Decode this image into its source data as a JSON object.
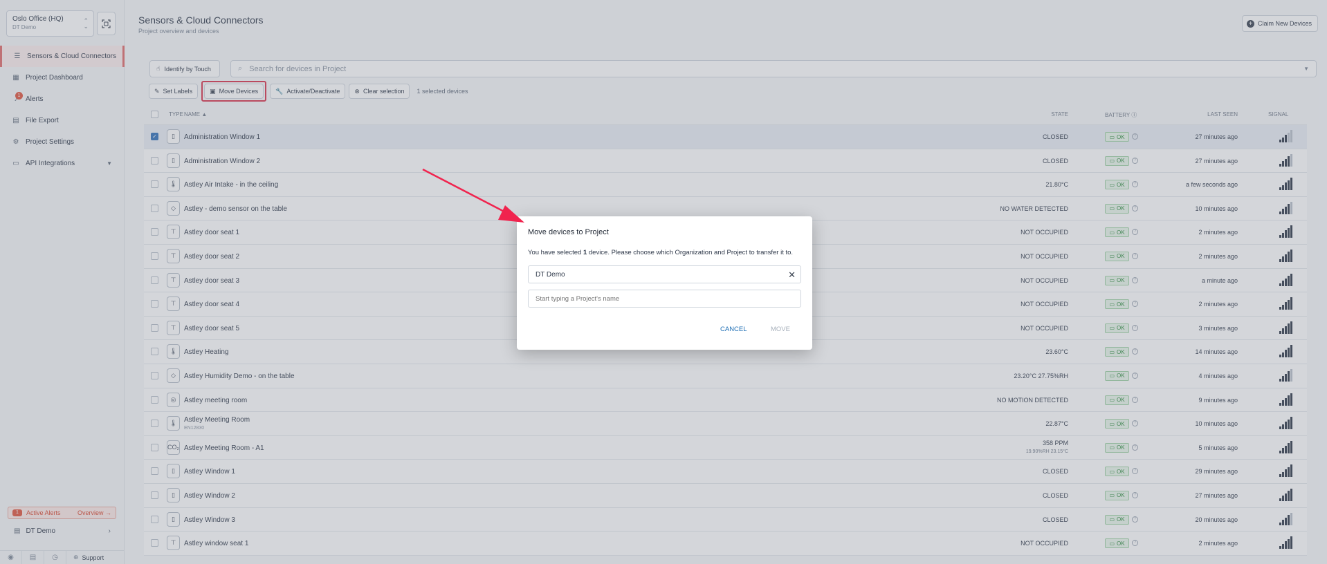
{
  "sidebar": {
    "org_name": "Oslo Office (HQ)",
    "org_sub": "DT Demo",
    "nav": [
      {
        "label": "Sensors & Cloud Connectors",
        "icon": "list-icon",
        "active": true
      },
      {
        "label": "Project Dashboard",
        "icon": "dashboard-icon"
      },
      {
        "label": "Alerts",
        "icon": "bell-icon",
        "badge": "1"
      },
      {
        "label": "File Export",
        "icon": "export-icon"
      },
      {
        "label": "Project Settings",
        "icon": "settings-icon"
      },
      {
        "label": "API Integrations",
        "icon": "api-icon"
      }
    ],
    "active_alerts": {
      "badge": "1",
      "label": "Active Alerts",
      "overview": "Overview"
    },
    "org_item": "DT Demo",
    "support": "Support"
  },
  "header": {
    "title": "Sensors & Cloud Connectors",
    "subtitle": "Project overview and devices",
    "claim_label": "Claim New Devices"
  },
  "toolbar": {
    "identify_label": "Identify by Touch",
    "search_placeholder": "Search for devices in Project",
    "set_labels": "Set Labels",
    "move_devices": "Move Devices",
    "activate": "Activate/Deactivate",
    "clear": "Clear selection",
    "selected_count": "1 selected devices"
  },
  "table": {
    "columns": {
      "type": "TYPE",
      "name": "NAME",
      "state": "STATE",
      "battery": "BATTERY",
      "last_seen": "LAST SEEN",
      "signal": "SIGNAL"
    },
    "rows": [
      {
        "name": "Administration Window 1",
        "icon": "window-icon",
        "glyph": "▯",
        "state": "CLOSED",
        "battery": "OK",
        "seen": "27 minutes ago",
        "bars": 3,
        "selected": true
      },
      {
        "name": "Administration Window 2",
        "icon": "window-icon",
        "glyph": "▯",
        "state": "CLOSED",
        "battery": "OK",
        "seen": "27 minutes ago",
        "bars": 4
      },
      {
        "name": "Astley Air Intake - in the ceiling",
        "icon": "thermometer-icon",
        "glyph": "🌡",
        "state": "21.80°C",
        "battery": "OK",
        "seen": "a few seconds ago",
        "bars": 5
      },
      {
        "name": "Astley - demo sensor on the table",
        "icon": "water-drop-icon",
        "glyph": "◇",
        "state": "NO WATER DETECTED",
        "battery": "OK",
        "seen": "10 minutes ago",
        "bars": 4
      },
      {
        "name": "Astley door seat 1",
        "icon": "desk-icon",
        "glyph": "⊤",
        "state": "NOT OCCUPIED",
        "battery": "OK",
        "seen": "2 minutes ago",
        "bars": 5
      },
      {
        "name": "Astley door seat 2",
        "icon": "desk-icon",
        "glyph": "⊤",
        "state": "NOT OCCUPIED",
        "battery": "OK",
        "seen": "2 minutes ago",
        "bars": 5
      },
      {
        "name": "Astley door seat 3",
        "icon": "desk-icon",
        "glyph": "⊤",
        "state": "NOT OCCUPIED",
        "battery": "OK",
        "seen": "a minute ago",
        "bars": 5
      },
      {
        "name": "Astley door seat 4",
        "icon": "desk-icon",
        "glyph": "⊤",
        "state": "NOT OCCUPIED",
        "battery": "OK",
        "seen": "2 minutes ago",
        "bars": 5
      },
      {
        "name": "Astley door seat 5",
        "icon": "desk-icon",
        "glyph": "⊤",
        "state": "NOT OCCUPIED",
        "battery": "OK",
        "seen": "3 minutes ago",
        "bars": 5
      },
      {
        "name": "Astley Heating",
        "icon": "thermometer-icon",
        "glyph": "🌡",
        "state": "23.60°C",
        "battery": "OK",
        "seen": "14 minutes ago",
        "bars": 5
      },
      {
        "name": "Astley Humidity Demo - on the table",
        "icon": "humidity-icon",
        "glyph": "◇",
        "state": "23.20°C 27.75%RH",
        "battery": "OK",
        "seen": "4 minutes ago",
        "bars": 4
      },
      {
        "name": "Astley meeting room",
        "icon": "motion-icon",
        "glyph": "◎",
        "state": "NO MOTION DETECTED",
        "battery": "OK",
        "seen": "9 minutes ago",
        "bars": 5
      },
      {
        "name": "Astley Meeting Room",
        "sub": "EN12830",
        "icon": "thermometer-icon",
        "glyph": "🌡",
        "state": "22.87°C",
        "battery": "OK",
        "seen": "10 minutes ago",
        "bars": 5
      },
      {
        "name": "Astley Meeting Room - A1",
        "icon": "co2-icon",
        "glyph": "CO₂",
        "state": "358 PPM",
        "state2": "19.90%RH 23.15°C",
        "battery": "OK",
        "seen": "5 minutes ago",
        "bars": 5
      },
      {
        "name": "Astley Window 1",
        "icon": "window-icon",
        "glyph": "▯",
        "state": "CLOSED",
        "battery": "OK",
        "seen": "29 minutes ago",
        "bars": 5
      },
      {
        "name": "Astley Window 2",
        "icon": "window-icon",
        "glyph": "▯",
        "state": "CLOSED",
        "battery": "OK",
        "seen": "27 minutes ago",
        "bars": 5
      },
      {
        "name": "Astley Window 3",
        "icon": "window-icon",
        "glyph": "▯",
        "state": "CLOSED",
        "battery": "OK",
        "seen": "20 minutes ago",
        "bars": 4
      },
      {
        "name": "Astley window seat 1",
        "icon": "desk-icon",
        "glyph": "⊤",
        "state": "NOT OCCUPIED",
        "battery": "OK",
        "seen": "2 minutes ago",
        "bars": 5
      }
    ]
  },
  "modal": {
    "title": "Move devices to Project",
    "text_pre": "You have selected ",
    "text_count": "1",
    "text_post": " device. Please choose which Organization and Project to transfer it to.",
    "org_value": "DT Demo",
    "project_placeholder": "Start typing a Project's name",
    "cancel": "CANCEL",
    "move": "MOVE"
  },
  "colors": {
    "accent": "#e0533d",
    "annotation": "#f0244e",
    "link": "#1f6fb5"
  }
}
